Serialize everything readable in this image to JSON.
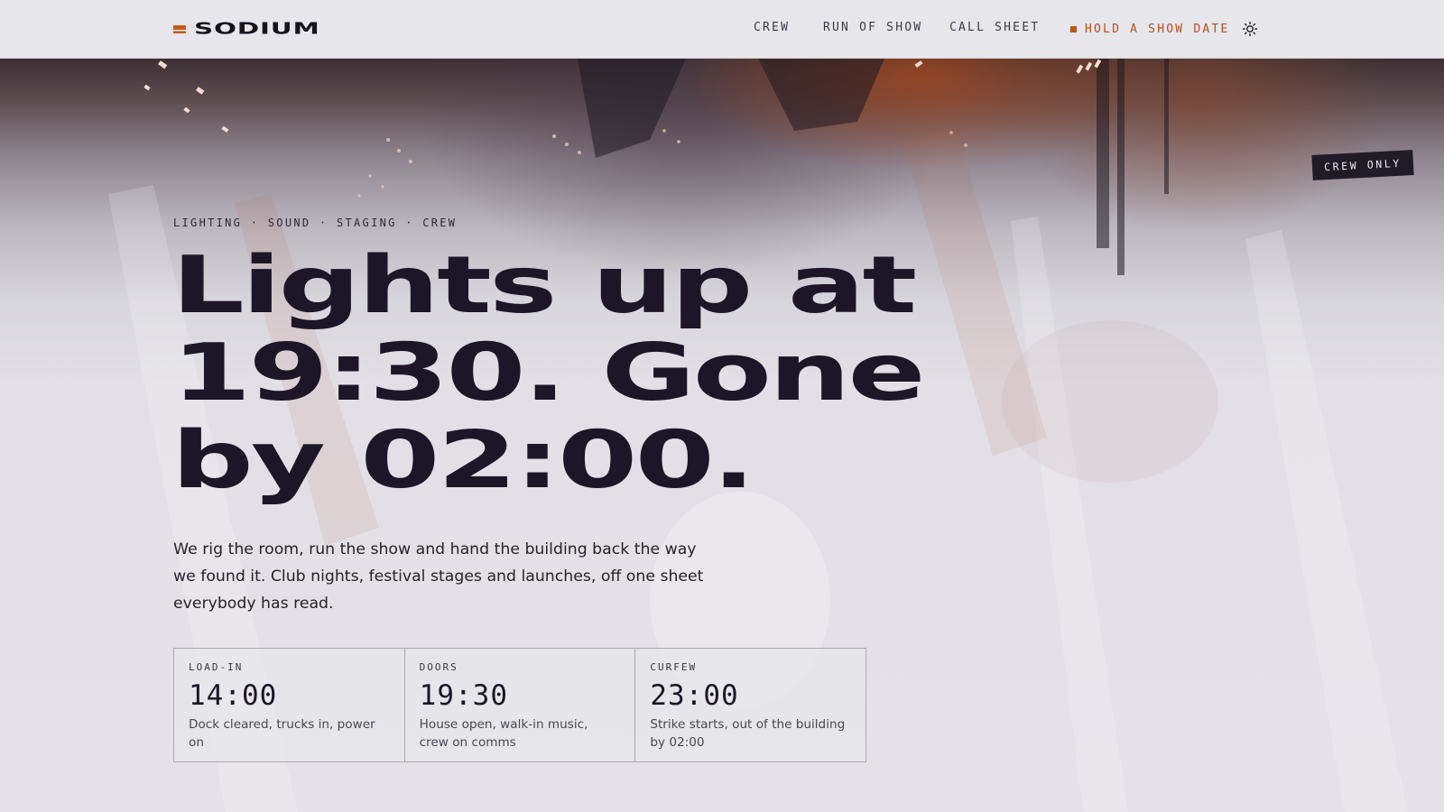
{
  "brand": {
    "name": "SODIUM"
  },
  "nav": {
    "items": [
      {
        "label": "CREW"
      },
      {
        "label": "RUN OF SHOW"
      },
      {
        "label": "CALL SHEET"
      }
    ],
    "cta_label": "HOLD A SHOW DATE",
    "theme_toggle_icon": "sun-icon"
  },
  "hero": {
    "badge": "CREW ONLY",
    "eyebrow": "LIGHTING · SOUND · STAGING · CREW",
    "headline_lines": [
      "Lights up at",
      "19:30. Gone",
      "by 02:00."
    ],
    "lede": "We rig the room, run the show and hand the building back the way we found it. Club nights, festival stages and launches, off one sheet everybody has read."
  },
  "schedule": [
    {
      "label": "LOAD-IN",
      "time": "14:00",
      "desc": "Dock cleared, trucks in, power on"
    },
    {
      "label": "DOORS",
      "time": "19:30",
      "desc": "House open, walk-in music, crew on comms"
    },
    {
      "label": "CURFEW",
      "time": "23:00",
      "desc": "Strike starts, out of the building by 02:00"
    }
  ],
  "colors": {
    "accent": "#c0531b",
    "ink": "#1c1628",
    "background": "#e4e3e8",
    "badge_bg": "#211a27"
  }
}
